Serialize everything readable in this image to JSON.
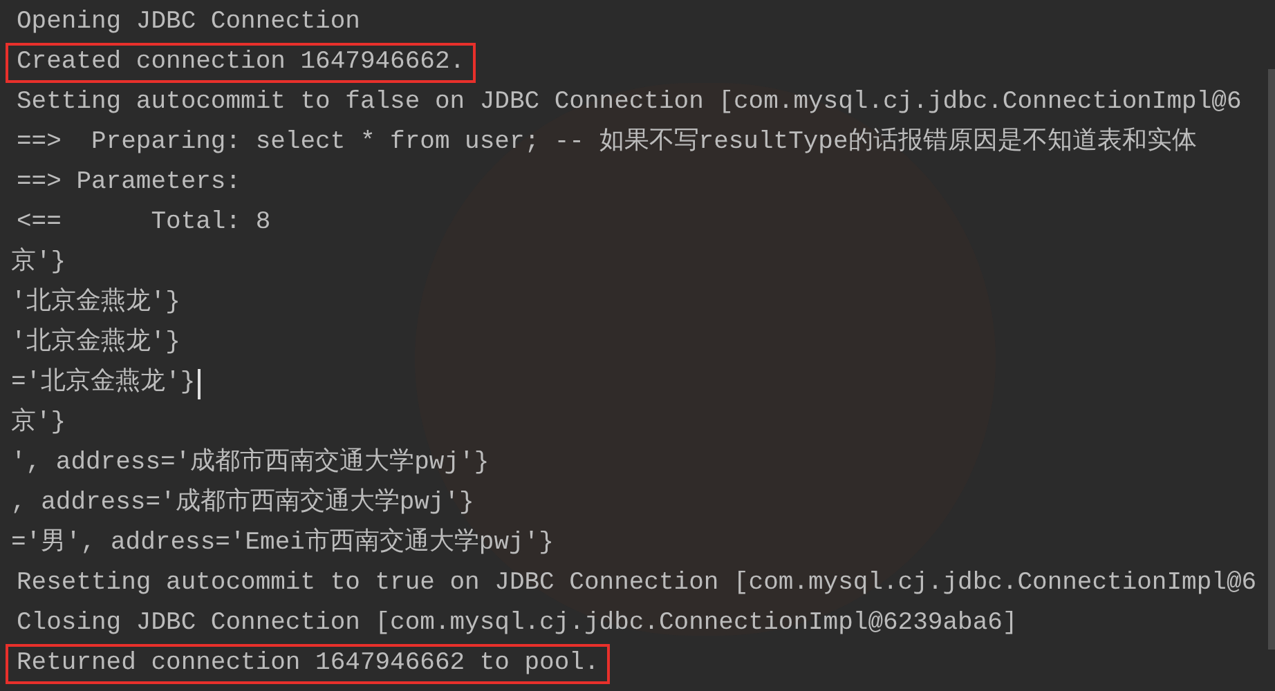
{
  "console": {
    "lines": [
      {
        "text": "Opening JDBC Connection",
        "highlighted": false,
        "cut_left": false,
        "cursor": false
      },
      {
        "text": "Created connection 1647946662.",
        "highlighted": true,
        "cut_left": false,
        "cursor": false
      },
      {
        "text": "Setting autocommit to false on JDBC Connection [com.mysql.cj.jdbc.ConnectionImpl@6",
        "highlighted": false,
        "cut_left": false,
        "cursor": false
      },
      {
        "text": "==>  Preparing: select * from user; -- 如果不写resultType的话报错原因是不知道表和实体",
        "highlighted": false,
        "cut_left": false,
        "cursor": false
      },
      {
        "text": "==> Parameters: ",
        "highlighted": false,
        "cut_left": false,
        "cursor": false
      },
      {
        "text": "<==      Total: 8",
        "highlighted": false,
        "cut_left": false,
        "cursor": false
      },
      {
        "text": "京'}",
        "highlighted": false,
        "cut_left": true,
        "cursor": false
      },
      {
        "text": "'北京金燕龙'}",
        "highlighted": false,
        "cut_left": true,
        "cursor": false
      },
      {
        "text": "'北京金燕龙'}",
        "highlighted": false,
        "cut_left": true,
        "cursor": false
      },
      {
        "text": "='北京金燕龙'}",
        "highlighted": false,
        "cut_left": true,
        "cursor": true
      },
      {
        "text": "京'}",
        "highlighted": false,
        "cut_left": true,
        "cursor": false
      },
      {
        "text": "', address='成都市西南交通大学pwj'}",
        "highlighted": false,
        "cut_left": true,
        "cursor": false
      },
      {
        "text": ", address='成都市西南交通大学pwj'}",
        "highlighted": false,
        "cut_left": true,
        "cursor": false
      },
      {
        "text": "='男', address='Emei市西南交通大学pwj'}",
        "highlighted": false,
        "cut_left": true,
        "cursor": false
      },
      {
        "text": "Resetting autocommit to true on JDBC Connection [com.mysql.cj.jdbc.ConnectionImpl@6",
        "highlighted": false,
        "cut_left": false,
        "cursor": false
      },
      {
        "text": "Closing JDBC Connection [com.mysql.cj.jdbc.ConnectionImpl@6239aba6]",
        "highlighted": false,
        "cut_left": false,
        "cursor": false
      },
      {
        "text": "Returned connection 1647946662 to pool.",
        "highlighted": true,
        "cut_left": false,
        "cursor": false
      }
    ]
  }
}
